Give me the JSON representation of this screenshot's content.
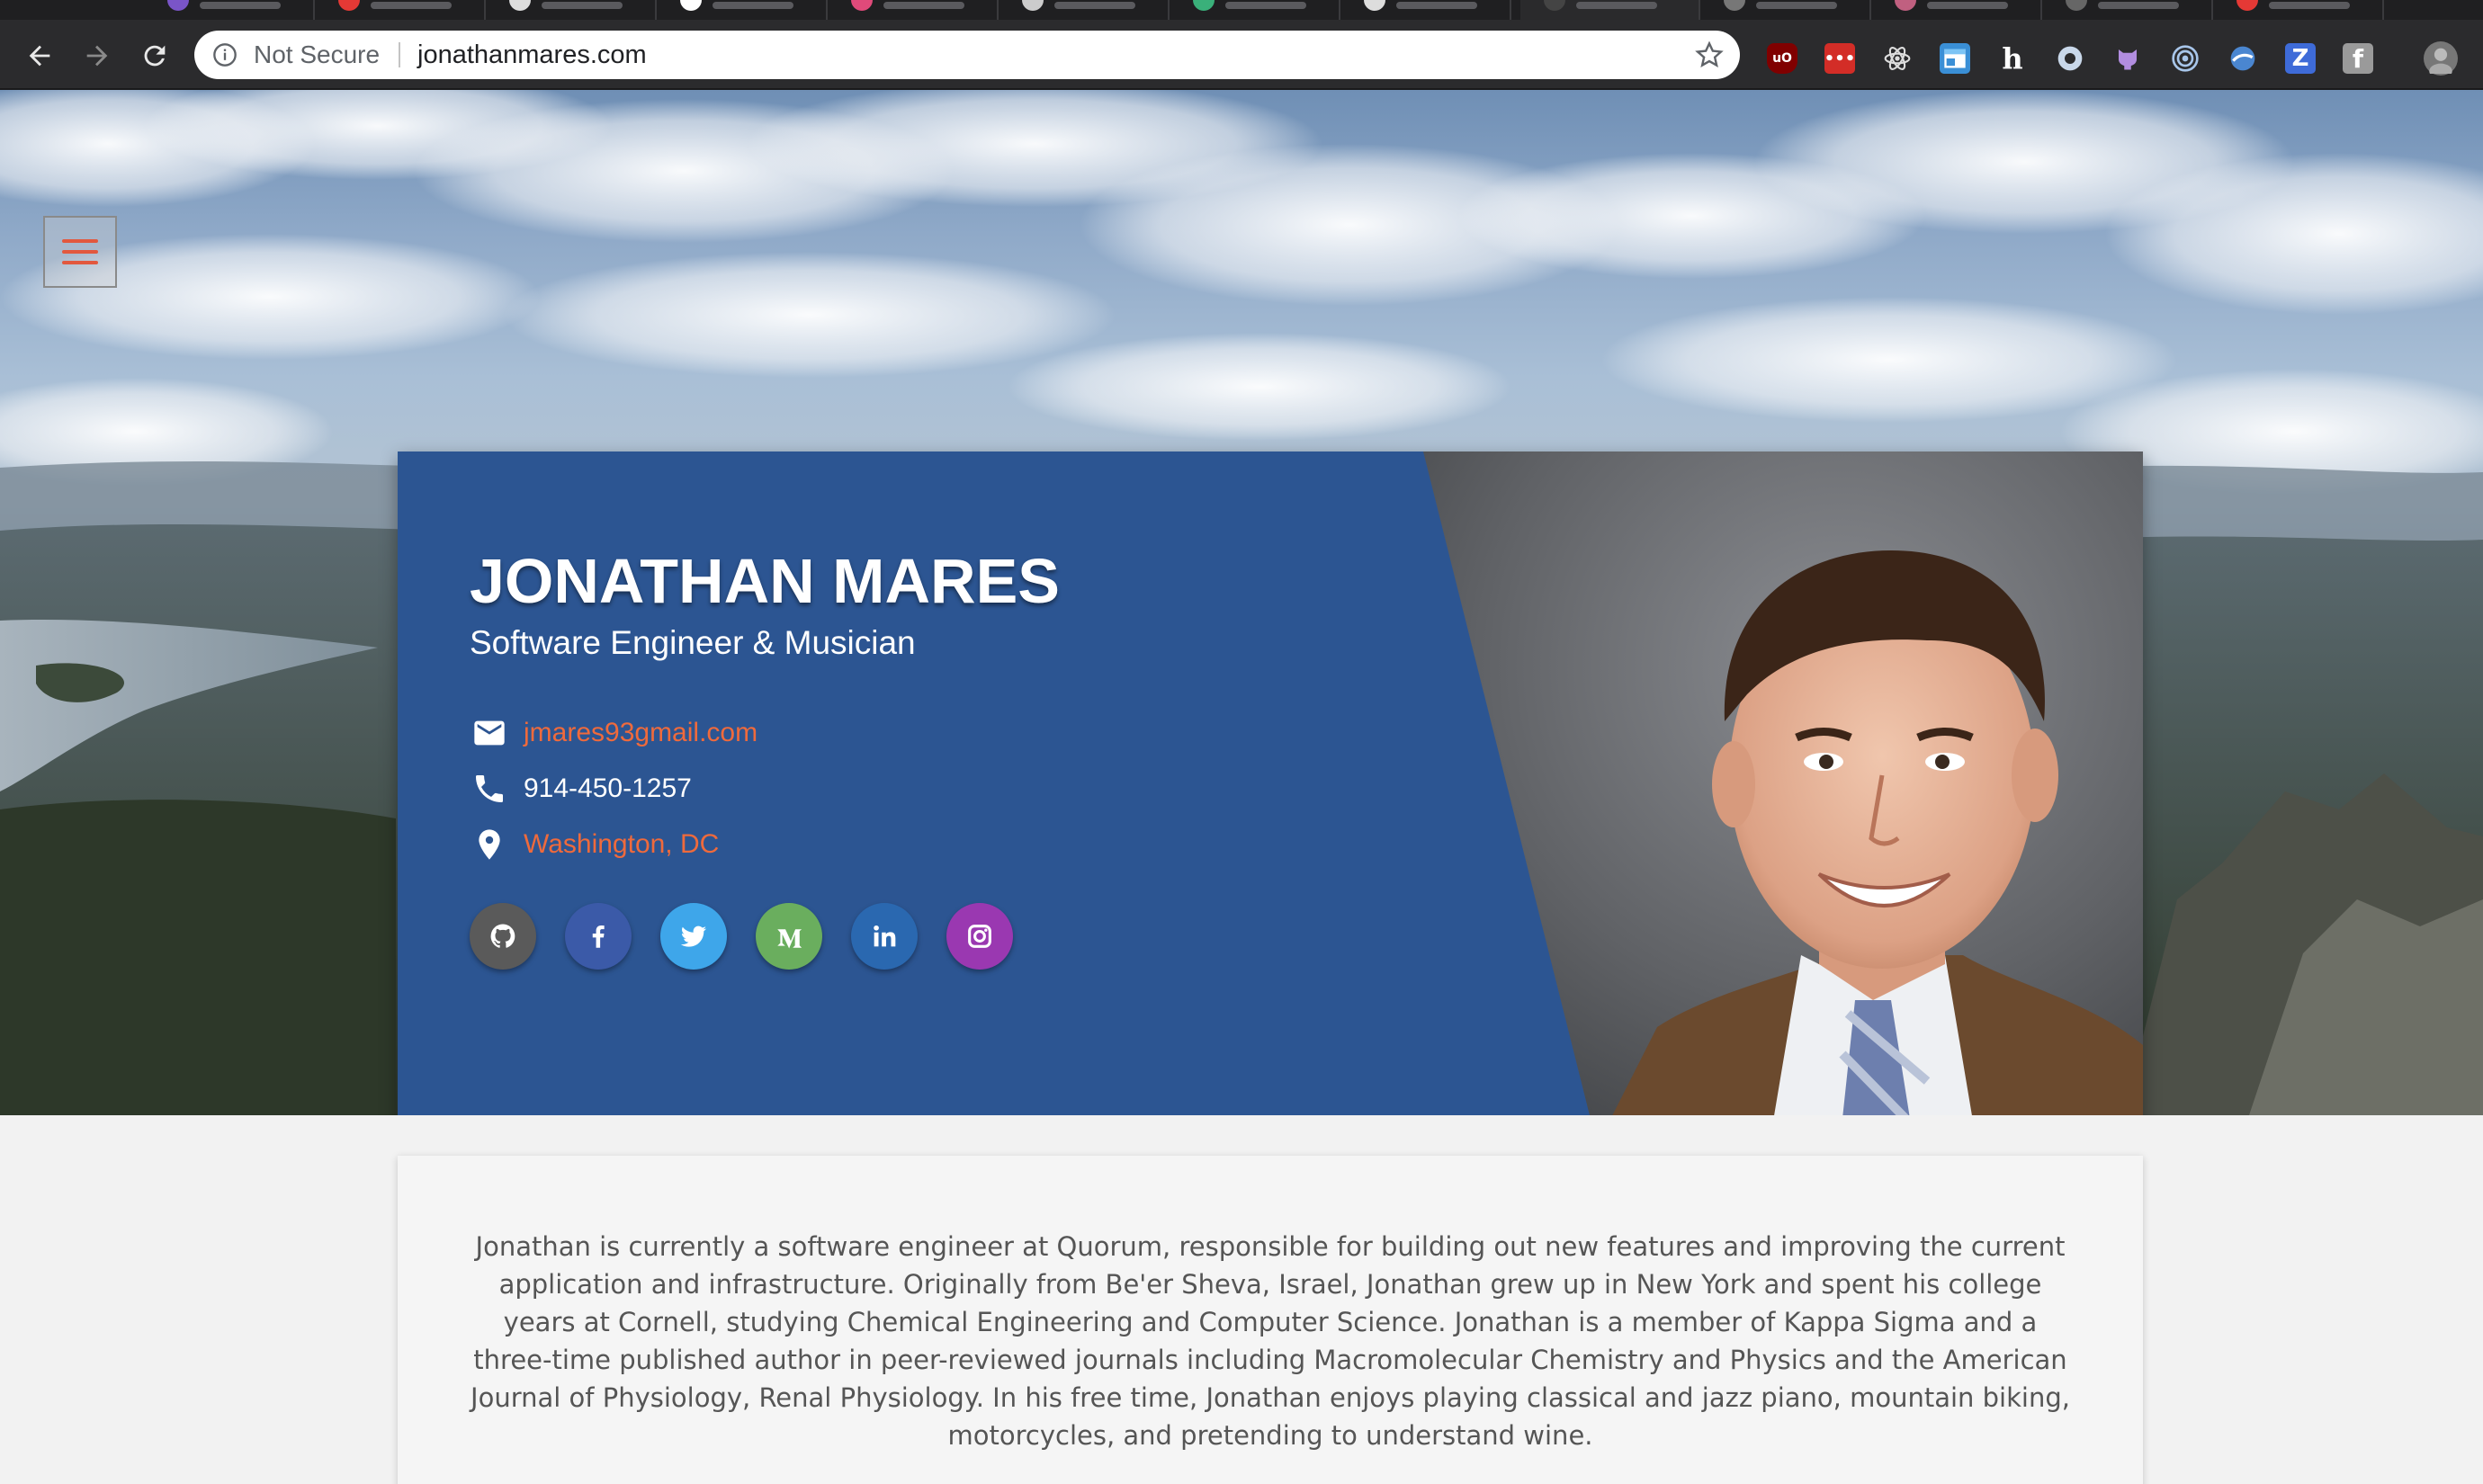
{
  "browser": {
    "security_label": "Not Secure",
    "url": "jonathanmares.com",
    "icons": {
      "back": "back-arrow-icon",
      "forward": "forward-arrow-icon",
      "reload": "reload-icon",
      "info": "info-icon",
      "bookmark": "star-icon"
    },
    "extensions": [
      "ublock-icon",
      "lastpass-icon",
      "react-devtools-icon",
      "window-icon",
      "h",
      "circle-icon",
      "github-cat-icon",
      "target-icon",
      "vpn-icon",
      "Z",
      "facebook-square-icon",
      "avatar"
    ]
  },
  "hero": {
    "menu_icon": "hamburger-menu-icon",
    "name": "JONATHAN MARES",
    "tagline": "Software Engineer & Musician",
    "contact": {
      "email": "jmares93gmail.com",
      "phone": "914-450-1257",
      "location": "Washington, DC"
    },
    "social": [
      {
        "icon": "github-icon",
        "color": "#5a5a5a"
      },
      {
        "icon": "facebook-icon",
        "color": "#3b5aa8"
      },
      {
        "icon": "twitter-icon",
        "color": "#3ea6ea"
      },
      {
        "icon": "medium-icon",
        "color": "#6aae5e"
      },
      {
        "icon": "linkedin-icon",
        "color": "#2a68b0"
      },
      {
        "icon": "instagram-icon",
        "color": "#9a38b1"
      }
    ],
    "colors": {
      "card": "#2c5592",
      "accent": "#ef6a3c"
    }
  },
  "about": {
    "text": "Jonathan is currently a software engineer at Quorum, responsible for building out new features and improving the current application and infrastructure. Originally from Be'er Sheva, Israel, Jonathan grew up in New York and spent his college years at Cornell, studying Chemical Engineering and Computer Science. Jonathan is a member of Kappa Sigma and a three-time published author in peer-reviewed journals including Macromolecular Chemistry and Physics and the American Journal of Physiology, Renal Physiology. In his free time, Jonathan enjoys playing classical and jazz piano, mountain biking, motorcycles, and pretending to understand wine."
  }
}
